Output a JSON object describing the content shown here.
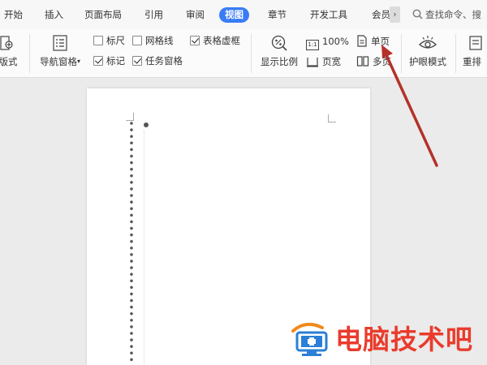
{
  "tabs": [
    {
      "label": "开始",
      "active": false
    },
    {
      "label": "插入",
      "active": false
    },
    {
      "label": "页面布局",
      "active": false
    },
    {
      "label": "引用",
      "active": false
    },
    {
      "label": "审阅",
      "active": false
    },
    {
      "label": "视图",
      "active": true
    },
    {
      "label": "章节",
      "active": false
    },
    {
      "label": "开发工具",
      "active": false
    },
    {
      "label": "会员",
      "active": false
    }
  ],
  "tab_more": "›",
  "search": {
    "text": "查找命令、搜"
  },
  "ribbon": {
    "layout_label": "版式",
    "nav_pane_label": "导航窗格",
    "nav_pane_arrow": "▾",
    "checkboxes": [
      {
        "label": "标尺",
        "checked": false
      },
      {
        "label": "网格线",
        "checked": false
      },
      {
        "label": "表格虚框",
        "checked": true
      },
      {
        "label": "标记",
        "checked": true
      },
      {
        "label": "任务窗格",
        "checked": true
      }
    ],
    "zoom_label": "显示比例",
    "zoom_100_icon": "1:1",
    "zoom_100": "100%",
    "page_width": "页宽",
    "single_page": "单页",
    "multi_page": "多页",
    "eye_mode": "护眼模式",
    "rearrange": "重排"
  },
  "watermark": {
    "text": "电脑技术吧"
  },
  "colors": {
    "accent": "#3a7cf5",
    "arrow": "#b4312a",
    "watermark": "#ea3b2c"
  }
}
